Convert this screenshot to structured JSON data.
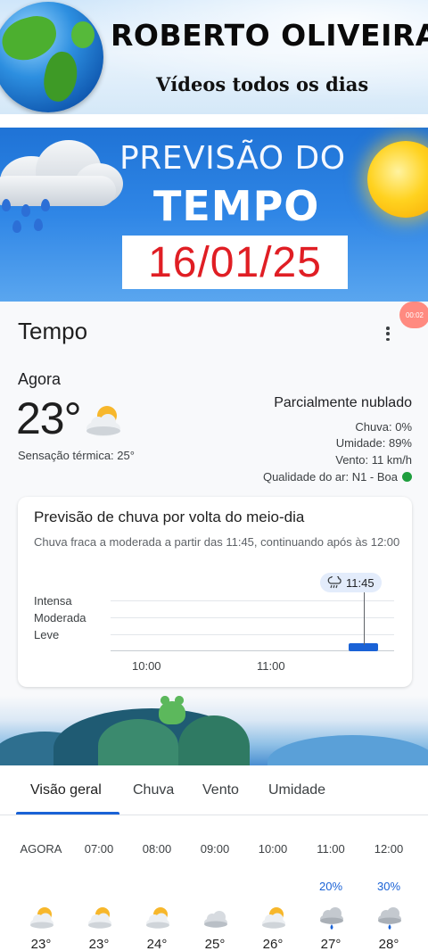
{
  "banner": {
    "name": "ROBERTO OLIVEIRA",
    "tagline": "Vídeos todos os dias"
  },
  "title_card": {
    "line1": "PREVISÃO DO",
    "line2": "TEMPO",
    "date": "16/01/25"
  },
  "badge": {
    "timer": "00:02"
  },
  "weather": {
    "app_title": "Tempo",
    "now_label": "Agora",
    "temperature": "23°",
    "feels_like": "Sensação térmica: 25°",
    "condition": "Parcialmente nublado",
    "rain": "Chuva: 0%",
    "humidity": "Umidade: 89%",
    "wind": "Vento: 11 km/h",
    "air_quality": "Qualidade do ar: N1 - Boa",
    "air_quality_color": "#1e9e3e"
  },
  "rain_forecast": {
    "title": "Previsão de chuva por volta do meio-dia",
    "description": "Chuva fraca a moderada a partir das 11:45, continuando após às 12:00",
    "levels": [
      "Intensa",
      "Moderada",
      "Leve"
    ],
    "marker_time": "11:45",
    "ticks": [
      "10:00",
      "11:00"
    ],
    "bar_color": "#1a62d6"
  },
  "tabs": [
    "Visão geral",
    "Chuva",
    "Vento",
    "Umidade"
  ],
  "active_tab": "Visão geral",
  "hourly": [
    {
      "time": "AGORA",
      "precip": "",
      "icon": "partly-cloudy-icon",
      "temp": "23°"
    },
    {
      "time": "07:00",
      "precip": "",
      "icon": "partly-cloudy-icon",
      "temp": "23°"
    },
    {
      "time": "08:00",
      "precip": "",
      "icon": "partly-cloudy-icon",
      "temp": "24°"
    },
    {
      "time": "09:00",
      "precip": "",
      "icon": "cloudy-icon",
      "temp": "25°"
    },
    {
      "time": "10:00",
      "precip": "",
      "icon": "partly-cloudy-icon",
      "temp": "26°"
    },
    {
      "time": "11:00",
      "precip": "20%",
      "icon": "rain-cloud-icon",
      "temp": "27°"
    },
    {
      "time": "12:00",
      "precip": "30%",
      "icon": "rain-cloud-icon",
      "temp": "28°"
    }
  ]
}
